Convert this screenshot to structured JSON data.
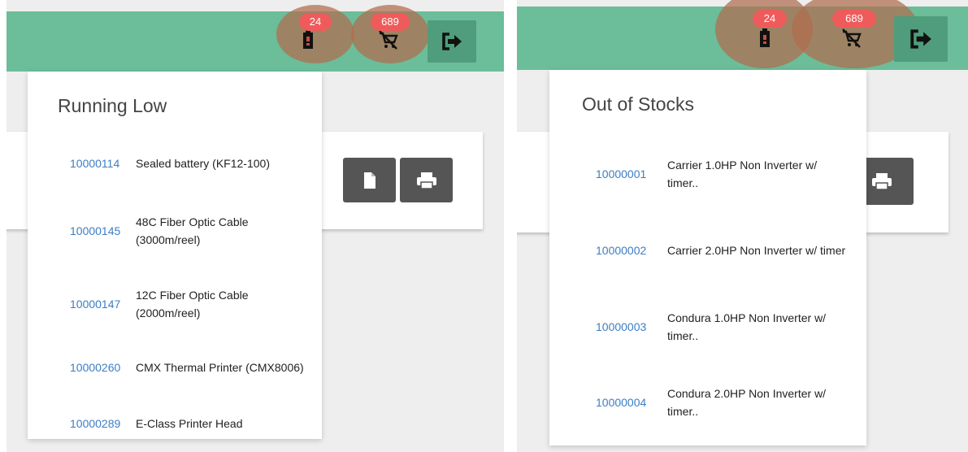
{
  "left": {
    "badges": {
      "low_stock_count": "24",
      "out_of_stock_count": "689"
    },
    "dropdown": {
      "title": "Running Low",
      "items": [
        {
          "code": "10000114",
          "name": "Sealed battery (KF12-100)"
        },
        {
          "code": "10000145",
          "name": "48C Fiber Optic Cable (3000m/reel)"
        },
        {
          "code": "10000147",
          "name": "12C Fiber Optic Cable (2000m/reel)"
        },
        {
          "code": "10000260",
          "name": "CMX Thermal Printer (CMX8006)"
        },
        {
          "code": "10000289",
          "name": "E-Class Printer Head"
        }
      ]
    }
  },
  "right": {
    "badges": {
      "low_stock_count": "24",
      "out_of_stock_count": "689"
    },
    "dropdown": {
      "title": "Out of Stocks",
      "items": [
        {
          "code": "10000001",
          "name": "Carrier 1.0HP Non Inverter w/ timer.."
        },
        {
          "code": "10000002",
          "name": "Carrier 2.0HP Non Inverter w/ timer"
        },
        {
          "code": "10000003",
          "name": "Condura 1.0HP Non Inverter w/ timer.."
        },
        {
          "code": "10000004",
          "name": "Condura 2.0HP Non Inverter w/ timer.."
        }
      ]
    }
  },
  "colors": {
    "topbar": "#6cbd99",
    "badge": "#ef5b5b",
    "link": "#3d7dc4",
    "dark_button": "#555555"
  },
  "icons": [
    "battery-low-icon",
    "cart-off-icon",
    "logout-icon",
    "document-icon",
    "printer-icon"
  ]
}
